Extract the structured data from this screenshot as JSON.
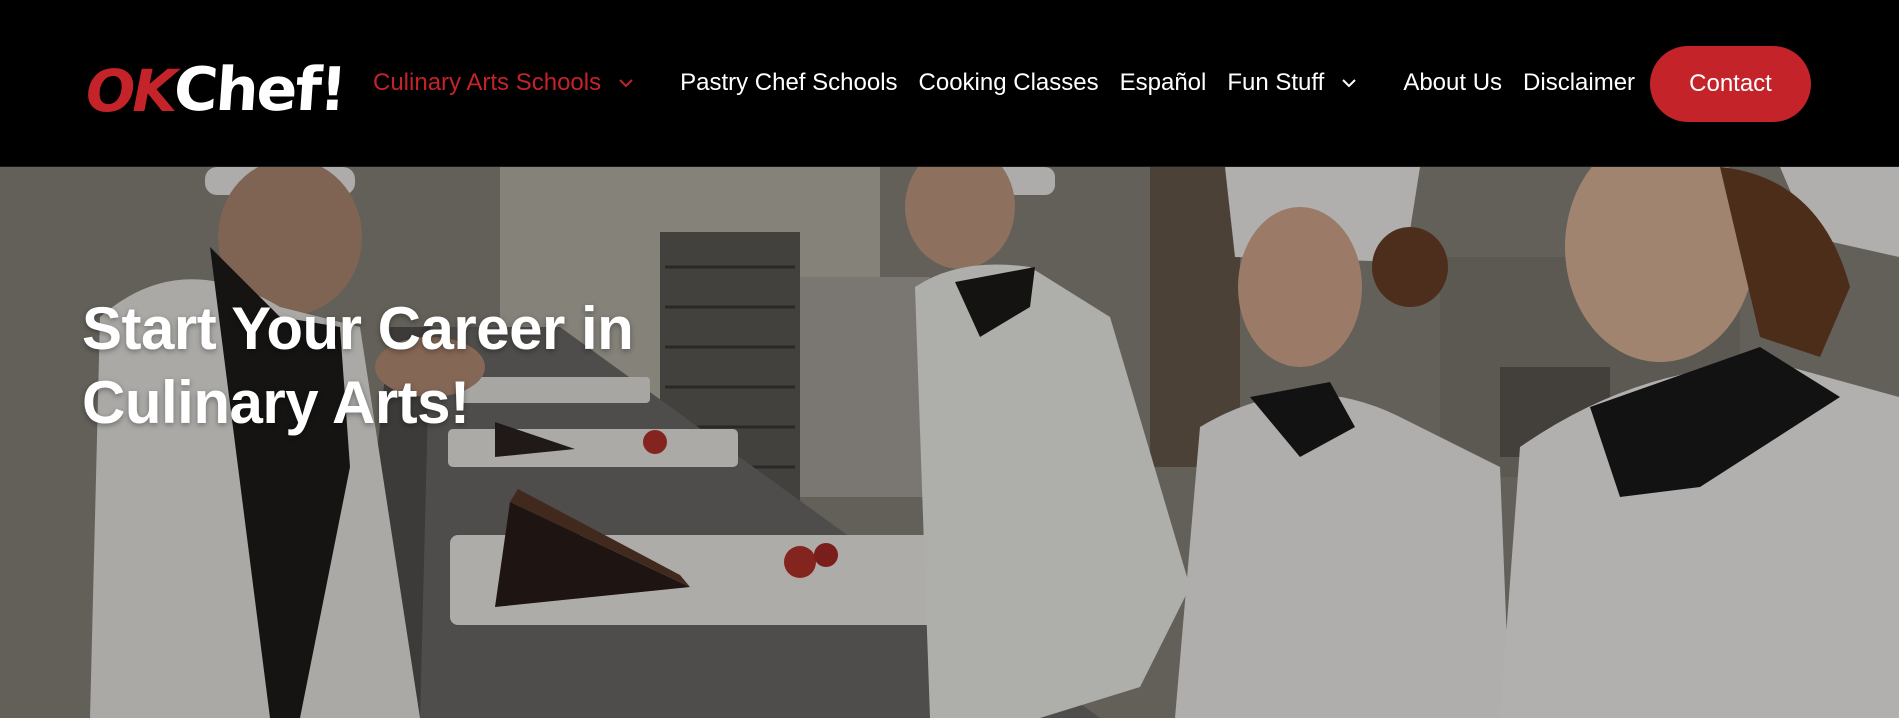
{
  "brand": {
    "logo_ok": "OK",
    "logo_chef": "Chef!",
    "accent_color": "#c4232a"
  },
  "nav": {
    "items": [
      {
        "label": "Culinary Arts Schools",
        "active": true,
        "has_dropdown": true
      },
      {
        "label": "Pastry Chef Schools",
        "active": false,
        "has_dropdown": false
      },
      {
        "label": "Cooking Classes",
        "active": false,
        "has_dropdown": false
      },
      {
        "label": "Español",
        "active": false,
        "has_dropdown": false
      },
      {
        "label": "Fun Stuff",
        "active": false,
        "has_dropdown": true
      },
      {
        "label": "About Us",
        "active": false,
        "has_dropdown": false
      },
      {
        "label": "Disclaimer",
        "active": false,
        "has_dropdown": false
      }
    ],
    "contact_label": "Contact"
  },
  "hero": {
    "title_line1": "Start Your Career in",
    "title_line2": "Culinary Arts!",
    "image_description_icon": "kitchen-chefs-photo"
  }
}
